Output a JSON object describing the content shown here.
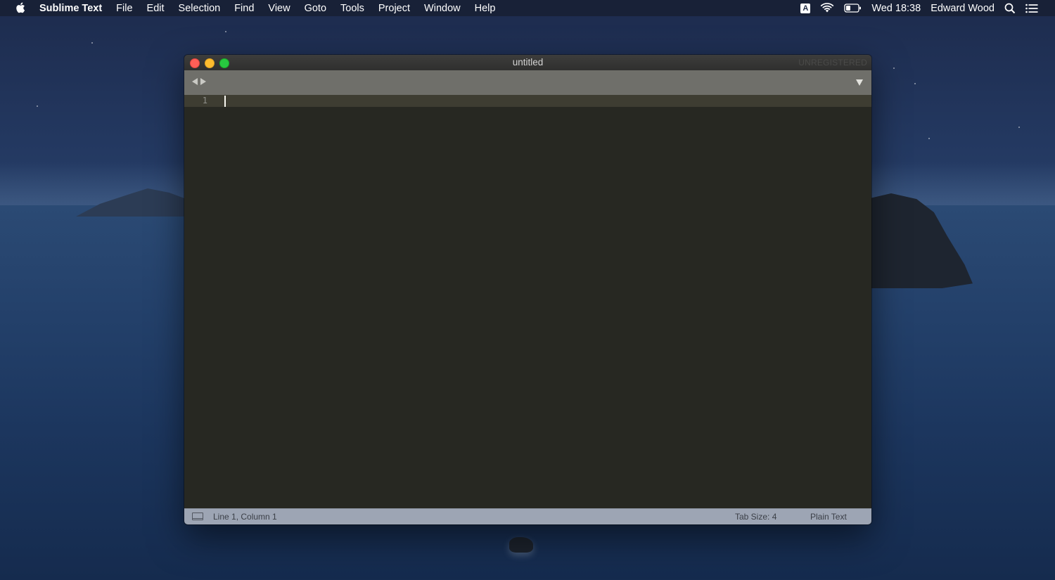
{
  "menubar": {
    "app_name": "Sublime Text",
    "items": [
      "File",
      "Edit",
      "Selection",
      "Find",
      "View",
      "Goto",
      "Tools",
      "Project",
      "Window",
      "Help"
    ],
    "input_source": "A",
    "clock": "Wed 18:38",
    "user": "Edward Wood",
    "icons": [
      "apple-icon",
      "wifi-icon",
      "battery-icon",
      "search-icon",
      "notification-list-icon"
    ]
  },
  "window": {
    "title": "untitled",
    "registration": "UNREGISTERED"
  },
  "editor": {
    "line_numbers": [
      "1"
    ],
    "content": ""
  },
  "statusbar": {
    "position": "Line 1, Column 1",
    "tab_size": "Tab Size: 4",
    "syntax": "Plain Text"
  },
  "colors": {
    "editor_bg": "#272822",
    "tabbar_bg": "#6f6f6a",
    "statusbar_bg": "#9da5b4",
    "close": "#ff5f57",
    "minimize": "#febc2e",
    "maximize": "#28c840"
  }
}
